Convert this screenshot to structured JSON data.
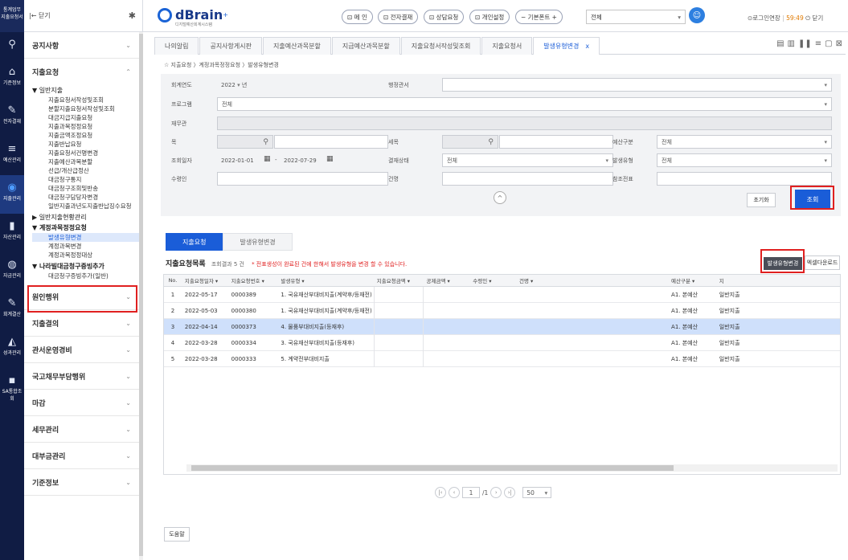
{
  "rail": {
    "top_label": "통계업무\n지출요청서",
    "items": [
      {
        "label": "",
        "icon": "search-icon"
      },
      {
        "label": "기준정보",
        "icon": "home-icon"
      },
      {
        "label": "전자결재",
        "icon": "pen-icon"
      },
      {
        "label": "예산관리",
        "icon": "coins-icon"
      },
      {
        "label": "지출관리",
        "icon": "wallet-icon"
      },
      {
        "label": "자산관리",
        "icon": "building-icon"
      },
      {
        "label": "자금관리",
        "icon": "money-icon"
      },
      {
        "label": "회계결산",
        "icon": "edit-icon"
      },
      {
        "label": "성과관리",
        "icon": "chart-icon"
      },
      {
        "label": "SA통합조회",
        "icon": "doc-icon"
      }
    ]
  },
  "menu": {
    "back_label": "|← 닫기",
    "sections_top": [
      {
        "label": "공지사항"
      },
      {
        "label": "지출요청"
      }
    ],
    "group1_title": "▼ 일반지출",
    "group1_items": [
      "지출요청서작성및조회",
      "분할지출요청서작성및조회",
      "대금지급지출요청",
      "지출과목정정요청",
      "지출금액조정요청",
      "지출반납요청",
      "지출요청서건명변경",
      "지출예산과목분할",
      "선급/개산급정산",
      "대금청구통지",
      "대금청구조회및반송",
      "대금청구담당자변경",
      "일반지출과년도지출반납징수요청"
    ],
    "group2_title": "▶ 일반지출현황관리",
    "group3_title": "▼ 계정과목정정요청",
    "group3_items": [
      "발생유형변경",
      "계정과목변경",
      "계정과목정정대상"
    ],
    "group4_title": "▼ 나라빌대금청구증빙추가",
    "group4_items": [
      "대금청구증빙추가(일반)"
    ],
    "sections_bottom": [
      {
        "label": "원인행위"
      },
      {
        "label": "지출결의"
      },
      {
        "label": "관서운영경비"
      },
      {
        "label": "국고채무부담행위"
      },
      {
        "label": "마감"
      },
      {
        "label": "세무관리"
      },
      {
        "label": "대부금관리"
      },
      {
        "label": "기준정보"
      }
    ]
  },
  "topbar": {
    "brand": "dBrain",
    "brand_sub": "디지털예산회계시스템",
    "buttons": [
      "⊡ 메 인",
      "⊡ 전자결재",
      "⊡ 상담요청",
      "⊡ 개인설정",
      "− 기본폰트 +"
    ],
    "select_value": "전체",
    "right_text": "⊙로그인연장",
    "timer": "59:49",
    "logout": "⏻ 닫기"
  },
  "tabs": [
    "나의알림",
    "공지사항게시판",
    "지출예산과목분할",
    "지급예산과목분할",
    "지출요청서작성및조회",
    "지출요청서",
    "발생유형변경"
  ],
  "active_tab_close": "x",
  "breadcrumb": "☆ 지출요청 〉계정과목정정요청 〉발생유형변경",
  "form": {
    "year_label": "회계연도",
    "year_value": "2022",
    "year_suffix": "년",
    "office_label": "행정관서",
    "program_label": "프로그램",
    "program_value": "전체",
    "finance_label": "재무관",
    "item_label": "목",
    "detail_label": "세목",
    "budget_type_label": "예산구분",
    "budget_type_value": "전체",
    "date_label": "조회일자",
    "date_from": "2022-01-01",
    "date_to": "2022-07-29",
    "approval_label": "결재상태",
    "approval_value": "전체",
    "occur_type_label": "발생유형",
    "occur_type_value": "전체",
    "payee_label": "수령인",
    "title_label": "건명",
    "ref_label": "참조전표",
    "reset": "초기화",
    "search": "조회",
    "collapse": "^"
  },
  "subtabs": [
    "지출요청",
    "발생유형변경"
  ],
  "list": {
    "title": "지출요청목록",
    "count": "조회결과 5 건",
    "note": "* 전표생성이 완료된 건에 한해서 발생유형을 변경 할 수 있습니다.",
    "change_button": "발생유형변경",
    "excel_button": "엑셀다운로드",
    "columns": [
      "No.",
      "지출요청일자",
      "지출요청번호",
      "발생유형",
      "지출요청금액",
      "공제금액",
      "수령인",
      "건명",
      "예산구분",
      "지"
    ],
    "rows": [
      {
        "no": "1",
        "date": "2022-05-17",
        "num": "0000389",
        "type": "1. 국유재산부대비지출(계약후/등재전)",
        "amount": "",
        "deduct": "",
        "payee": "",
        "title": "",
        "budget": "A1. 본예산",
        "extra": "일반지출"
      },
      {
        "no": "2",
        "date": "2022-05-03",
        "num": "0000380",
        "type": "1. 국유재산부대비지출(계약후/등재전)",
        "amount": "",
        "deduct": "",
        "payee": "",
        "title": "",
        "budget": "A1. 본예산",
        "extra": "일반지출"
      },
      {
        "no": "3",
        "date": "2022-04-14",
        "num": "0000373",
        "type": "4. 물품부대비지출(등재후)",
        "amount": "",
        "deduct": "",
        "payee": "",
        "title": "",
        "budget": "A1. 본예산",
        "extra": "일반지출"
      },
      {
        "no": "4",
        "date": "2022-03-28",
        "num": "0000334",
        "type": "3. 국유재산부대비지출(등재후)",
        "amount": "",
        "deduct": "",
        "payee": "",
        "title": "",
        "budget": "A1. 본예산",
        "extra": "일반지출"
      },
      {
        "no": "5",
        "date": "2022-03-28",
        "num": "0000333",
        "type": "5. 계약전부대비지출",
        "amount": "",
        "deduct": "",
        "payee": "",
        "title": "",
        "budget": "A1. 본예산",
        "extra": "일반지출"
      }
    ],
    "selected_row": 3
  },
  "pager": {
    "page": "1",
    "total": "/1",
    "size": "50"
  },
  "help_button": "도움말"
}
